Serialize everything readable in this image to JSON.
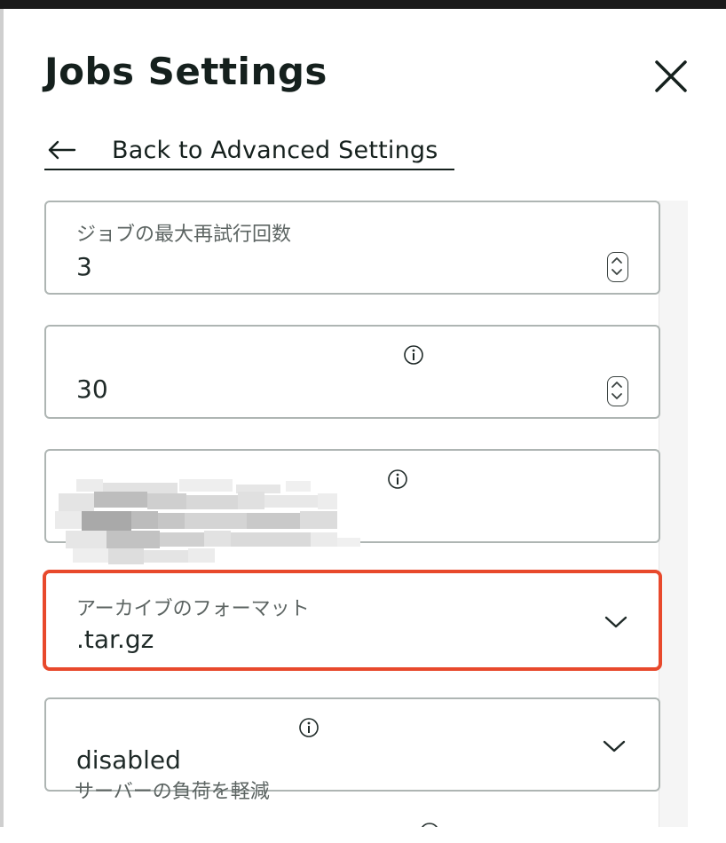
{
  "dialog": {
    "title": "Jobs Settings",
    "back_label": "Back to Advanced Settings"
  },
  "fields": [
    {
      "label": "ジョブの最大再試行回数",
      "value": "3",
      "control": "number-stepper"
    },
    {
      "label": "",
      "value": "30",
      "control": "number-stepper",
      "has_info": true
    },
    {
      "label": "",
      "value": "",
      "control": "redacted",
      "has_info": true
    },
    {
      "label": "アーカイブのフォーマット",
      "value": ".tar.gz",
      "control": "select",
      "focused": true
    },
    {
      "label": "",
      "value": "disabled",
      "control": "select",
      "has_info": true,
      "helper": "サーバーの負荷を軽減"
    }
  ],
  "colors": {
    "focus_border": "#e8492c",
    "field_border": "#aeb5b3",
    "text_primary": "#1f2a28",
    "text_secondary": "#5c6462"
  },
  "icons": [
    "close-icon",
    "back-arrow-icon",
    "info-icon",
    "stepper-icon",
    "chevron-down-icon"
  ]
}
